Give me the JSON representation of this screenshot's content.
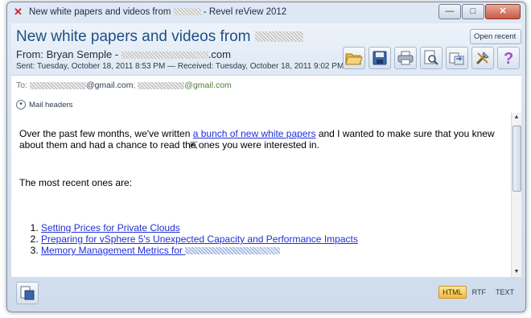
{
  "window": {
    "title_prefix": "New white papers and videos from",
    "title_suffix": "- Revel reView 2012",
    "controls": {
      "minimize": "—",
      "maximize": "□",
      "close": "✕"
    }
  },
  "header": {
    "subject": "New white papers and videos from",
    "from_label": "From:",
    "from_name": "Bryan Semple -",
    "from_domain_suffix": ".com",
    "sent": "Sent: Tuesday, October 18, 2011 8:53 PM — Received: Tuesday, October 18, 2011 9:02 PM",
    "open_recent": "Open recent ▾",
    "toolbar": [
      "folder-open-icon",
      "save-icon",
      "print-icon",
      "preview-icon",
      "export-icon",
      "settings-icon",
      "help-icon"
    ]
  },
  "recipients": {
    "to_label": "To:",
    "to_suffix_1": "@gmail.com",
    "to_suffix_2": "@gmail.com",
    "mail_headers": "Mail headers"
  },
  "body": {
    "para1_before": "Over the past few months, we've written ",
    "para1_link": "a bunch of new white papers",
    "para1_after": " and I wanted to make sure that you knew about them and had a chance to read the ones you were interested in.",
    "para2": "The most recent ones are:",
    "list": [
      "Setting Prices for Private Clouds",
      "Preparing for vSphere 5's Unexpected Capacity and Performance Impacts",
      "Memory Management Metrics  for"
    ]
  },
  "status": {
    "formats": [
      "HTML",
      "RTF",
      "TEXT"
    ],
    "selected_format": "HTML"
  },
  "colors": {
    "subject": "#1d4f86",
    "link": "#1f2fd6",
    "accent_border": "#c9574b"
  }
}
